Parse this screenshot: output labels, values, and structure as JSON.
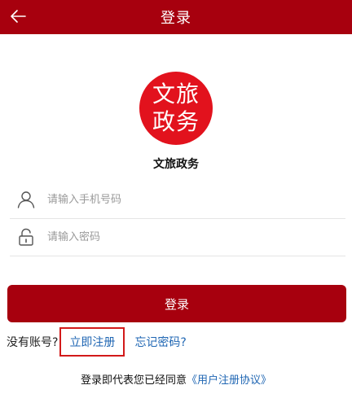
{
  "header": {
    "title": "登录",
    "back_icon": "arrow-left-icon",
    "bg_color": "#a7000e"
  },
  "logo": {
    "line1": "文旅",
    "line2": "政务",
    "bg_color": "#e2121d"
  },
  "app_name": "文旅政务",
  "form": {
    "phone": {
      "icon": "user-icon",
      "placeholder": "请输入手机号码",
      "value": ""
    },
    "password": {
      "icon": "lock-icon",
      "placeholder": "请输入密码",
      "value": ""
    },
    "login_label": "登录"
  },
  "links": {
    "no_account": "没有账号?",
    "register": "立即注册",
    "forgot": "忘记密码?"
  },
  "agreement": {
    "prefix": "登录即代表您已经同意",
    "link": "《用户注册协议》"
  },
  "colors": {
    "primary": "#a7000e",
    "link": "#1f66b3",
    "highlight_border": "#d21a1a"
  }
}
